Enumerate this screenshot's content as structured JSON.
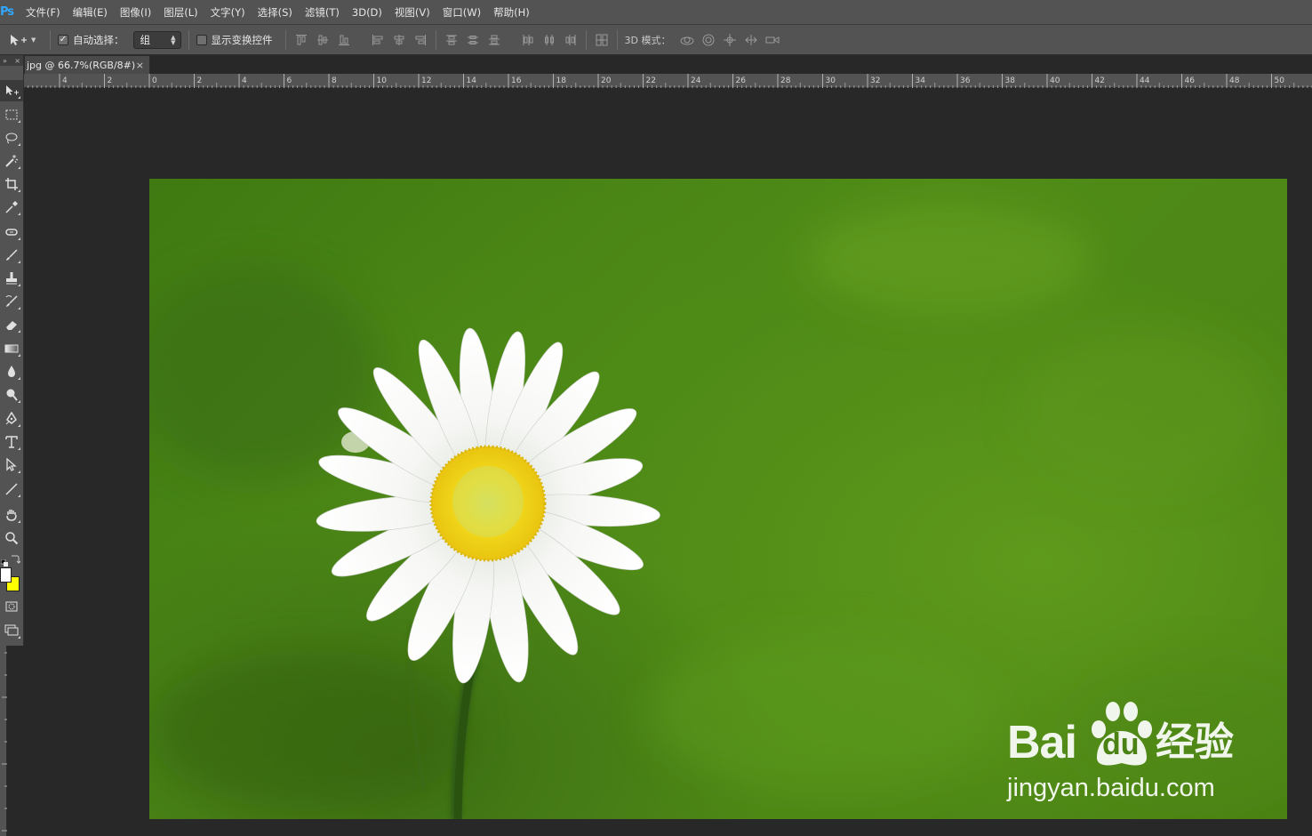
{
  "app": {
    "logo": "Ps"
  },
  "menu": [
    "文件(F)",
    "编辑(E)",
    "图像(I)",
    "图层(L)",
    "文字(Y)",
    "选择(S)",
    "滤镜(T)",
    "3D(D)",
    "视图(V)",
    "窗口(W)",
    "帮助(H)"
  ],
  "options": {
    "auto_select_label": "自动选择：",
    "auto_select_checked": true,
    "auto_select_value": "组",
    "show_transform_label": "显示变换控件",
    "show_transform_checked": false,
    "mode3d_label": "3D 模式："
  },
  "document": {
    "tab_title": "jpg @ 66.7%(RGB/8#)",
    "close_glyph": "×"
  },
  "toolbar_head": {
    "expand": "»",
    "close": "×"
  },
  "ruler": {
    "labels": [
      "4",
      "2",
      "0",
      "2",
      "4",
      "6",
      "8",
      "10",
      "12",
      "14",
      "16",
      "18",
      "20",
      "22",
      "24",
      "26",
      "28",
      "30",
      "32",
      "34",
      "36",
      "38",
      "40",
      "42",
      "44",
      "46",
      "48",
      "50"
    ]
  },
  "swatches": {
    "foreground": "#ffffff",
    "background": "#ffff00"
  },
  "watermark": {
    "bai": "Bai",
    "du": "du",
    "chinese": "经验",
    "url": "jingyan.baidu.com"
  },
  "tools": [
    "move-tool",
    "marquee-tool",
    "lasso-tool",
    "magic-wand-tool",
    "crop-tool",
    "eyedropper-tool",
    "healing-brush-tool",
    "brush-tool",
    "clone-stamp-tool",
    "history-brush-tool",
    "eraser-tool",
    "gradient-tool",
    "blur-tool",
    "dodge-tool",
    "pen-tool",
    "type-tool",
    "path-selection-tool",
    "line-tool",
    "hand-tool",
    "zoom-tool"
  ]
}
